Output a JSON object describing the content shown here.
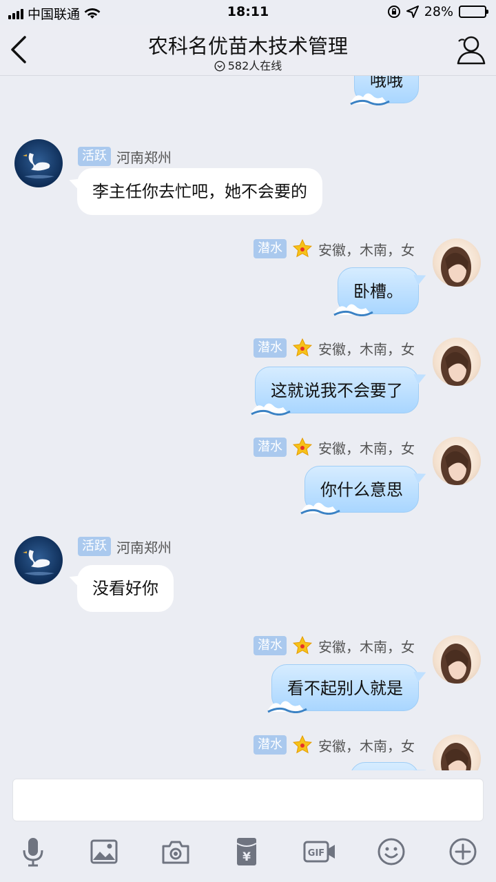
{
  "status_bar": {
    "carrier": "中国联通",
    "time": "18:11",
    "battery": "28%",
    "battery_level": 0.28
  },
  "header": {
    "title": "农科名优苗木技术管理",
    "online": "582人在线"
  },
  "messages": [
    {
      "side": "out",
      "text": "哦哦"
    },
    {
      "side": "in",
      "badge": "活跃",
      "location": "河南郑州",
      "text": "李主任你去忙吧，她不会要的"
    },
    {
      "side": "out",
      "badge": "潜水",
      "location": "安徽，木南，女",
      "text": "卧槽。"
    },
    {
      "side": "out",
      "badge": "潜水",
      "location": "安徽，木南，女",
      "text": "这就说我不会要了"
    },
    {
      "side": "out",
      "badge": "潜水",
      "location": "安徽，木南，女",
      "text": "你什么意思"
    },
    {
      "side": "in",
      "badge": "活跃",
      "location": "河南郑州",
      "text": "没看好你"
    },
    {
      "side": "out",
      "badge": "潜水",
      "location": "安徽，木南，女",
      "text": "看不起别人就是"
    },
    {
      "side": "out",
      "badge": "潜水",
      "location": "安徽，木南，女",
      "text": ""
    }
  ],
  "input": {
    "value": ""
  },
  "toolbar": [
    "mic-icon",
    "image-icon",
    "camera-icon",
    "red-packet-icon",
    "gif-icon",
    "emoji-icon",
    "plus-icon"
  ],
  "colors": {
    "bubble_out": "#b7dcff",
    "bubble_in": "#ffffff",
    "badge": "#aac9ee",
    "background": "#ebedf3"
  }
}
